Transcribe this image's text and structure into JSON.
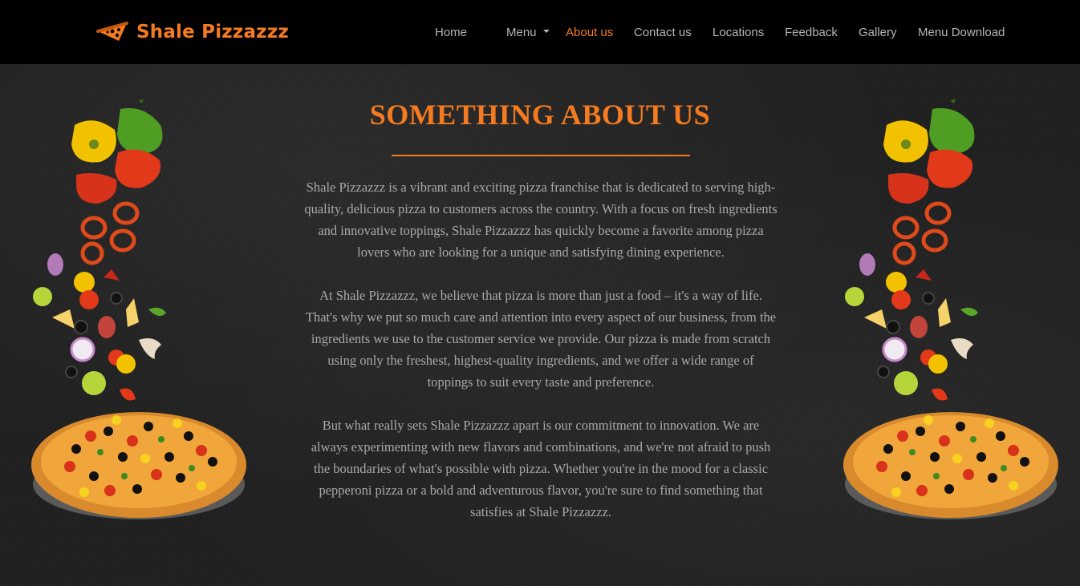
{
  "brand": {
    "name": "Shale Pizzazzz",
    "logo_icon": "pizza-slice-icon",
    "accent_color": "#f47b20"
  },
  "nav": {
    "items": [
      {
        "label": "Home"
      },
      {
        "label": "Menu",
        "has_dropdown": true
      },
      {
        "label": "About us",
        "active": true
      },
      {
        "label": "Contact us"
      },
      {
        "label": "Locations"
      },
      {
        "label": "Feedback"
      },
      {
        "label": "Gallery"
      },
      {
        "label": "Menu Download"
      }
    ]
  },
  "about": {
    "title": "SOMETHING ABOUT US",
    "paragraphs": [
      "Shale Pizzazzz is a vibrant and exciting pizza franchise that is dedicated to serving high-quality, delicious pizza to customers across the country. With a focus on fresh ingredients and innovative toppings, Shale Pizzazzz has quickly become a favorite among pizza lovers who are looking for a unique and satisfying dining experience.",
      "At Shale Pizzazzz, we believe that pizza is more than just a food – it's a way of life. That's why we put so much care and attention into every aspect of our business, from the ingredients we use to the customer service we provide. Our pizza is made from scratch using only the freshest, highest-quality ingredients, and we offer a wide range of toppings to suit every taste and preference.",
      "But what really sets Shale Pizzazzz apart is our commitment to innovation. We are always experimenting with new flavors and combinations, and we're not afraid to push the boundaries of what's possible with pizza. Whether you're in the mood for a classic pepperoni pizza or a bold and adventurous flavor, you're sure to find something that satisfies at Shale Pizzazzz."
    ]
  },
  "decor": {
    "left_image": "pizza-ingredients-image",
    "right_image": "pizza-ingredients-image"
  }
}
